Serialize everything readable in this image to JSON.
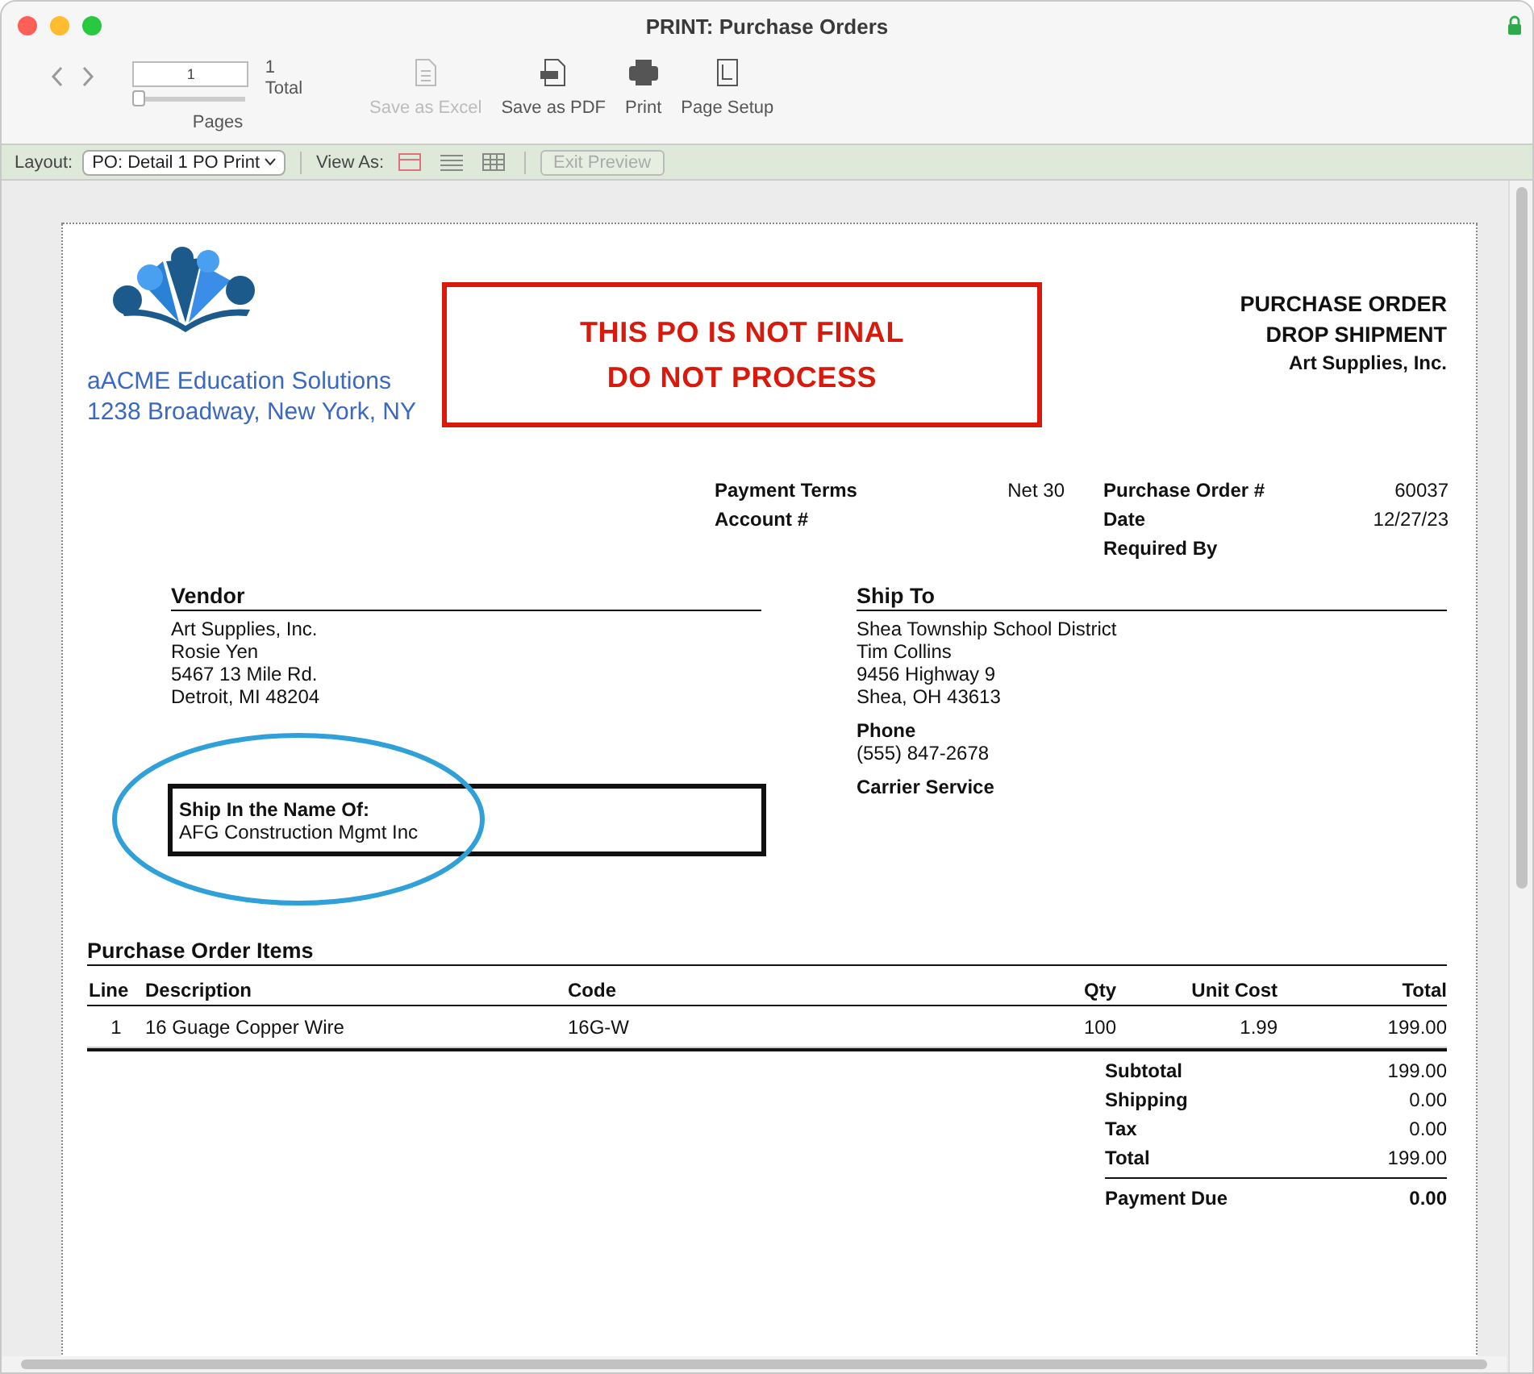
{
  "window": {
    "title": "PRINT: Purchase Orders"
  },
  "toolbar": {
    "page_field": {
      "value": "1"
    },
    "total": "1",
    "total_label": "Total",
    "pages_label": "Pages",
    "slider": {
      "level": 0
    },
    "actions": [
      {
        "label": "Save as Excel",
        "kind": "excel",
        "disabled": true
      },
      {
        "label": "Save as PDF",
        "kind": "pdf",
        "disabled": false
      },
      {
        "label": "Print",
        "kind": "print",
        "disabled": false
      },
      {
        "label": "Page Setup",
        "kind": "setup",
        "disabled": false
      }
    ]
  },
  "layout_bar": {
    "layout_label": "Layout:",
    "layout_value": "PO: Detail 1 PO Print",
    "view_label": "View As:",
    "views": [
      {
        "kind": "form",
        "selected": true
      },
      {
        "kind": "list",
        "selected": false
      },
      {
        "kind": "table",
        "selected": false
      }
    ],
    "exit_button": {
      "label": "Exit Preview",
      "disabled": true
    }
  },
  "document": {
    "company": {
      "name": "aACME Education Solutions",
      "address": "1238 Broadway, New York, NY"
    },
    "warning": [
      "THIS PO IS NOT FINAL",
      "DO NOT PROCESS"
    ],
    "title": [
      "PURCHASE ORDER",
      "DROP SHIPMENT"
    ],
    "title_vendor": "Art Supplies, Inc.",
    "terms": [
      {
        "label": "Payment Terms",
        "value": "Net 30"
      },
      {
        "label": "Account #"
      }
    ],
    "order_info": [
      {
        "label": "Purchase Order #",
        "value": "60037"
      },
      {
        "label": "Date",
        "value": "12/27/23"
      },
      {
        "label": "Required By"
      }
    ],
    "vendor": {
      "heading": "Vendor",
      "lines": [
        "Art Supplies, Inc.",
        "Rosie Yen",
        "5467 13 Mile Rd.",
        "Detroit, MI 48204"
      ]
    },
    "ship_name": {
      "label": "Ship In the Name Of:",
      "value": "AFG Construction Mgmt Inc"
    },
    "ship_to": {
      "heading": "Ship To",
      "lines": [
        "Shea Township School District",
        "Tim Collins",
        "9456 Highway 9",
        "Shea, OH 43613"
      ],
      "phone_label": "Phone",
      "phone": "(555) 847-2678",
      "carrier_label": "Carrier Service"
    },
    "items": {
      "heading": "Purchase Order Items",
      "columns": [
        "Line",
        "Description",
        "Code",
        "Qty",
        "Unit Cost",
        "Total"
      ],
      "rows": [
        [
          "1",
          "16 Guage Copper Wire",
          "16G-W",
          "100",
          "1.99",
          "199.00"
        ]
      ]
    },
    "totals": [
      {
        "label": "Subtotal",
        "value": "199.00"
      },
      {
        "label": "Shipping",
        "value": "0.00"
      },
      {
        "label": "Tax",
        "value": "0.00"
      },
      {
        "label": "Total",
        "value": "199.00"
      }
    ],
    "payment_due": {
      "label": "Payment Due",
      "value": "0.00"
    }
  }
}
